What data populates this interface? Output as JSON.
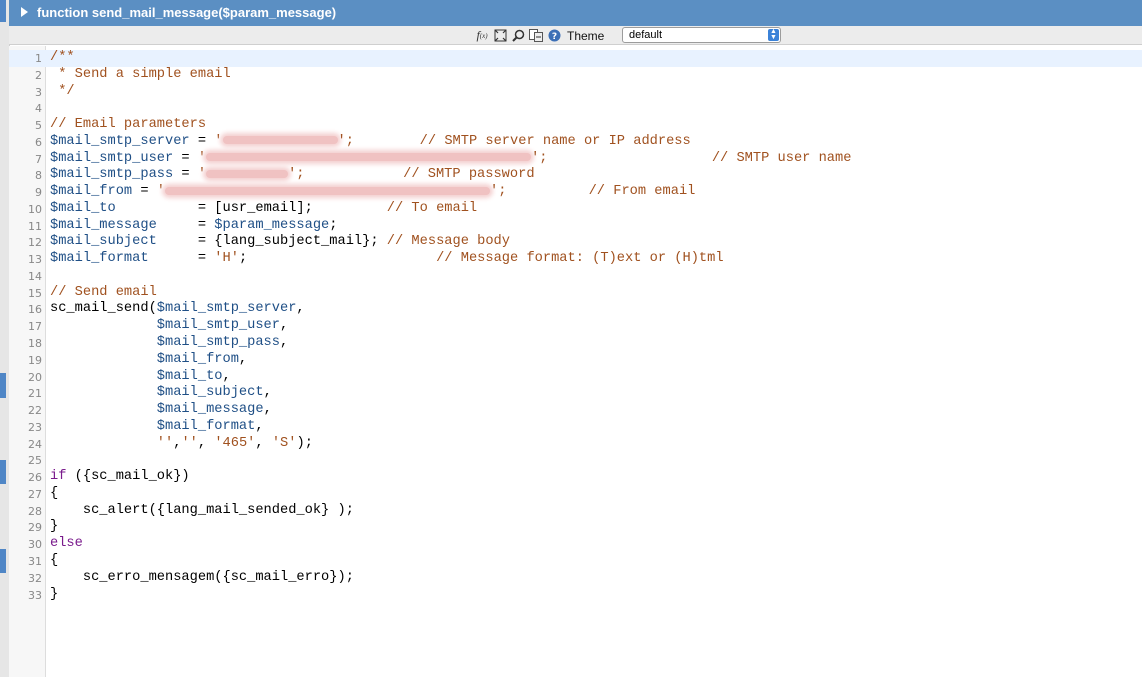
{
  "window": {
    "function_title": "function send_mail_message($param_message)"
  },
  "toolbar": {
    "icons": [
      "function-icon",
      "fullscreen-icon",
      "search-icon",
      "replace-icon",
      "help-icon"
    ],
    "theme_label": "Theme",
    "theme_value": "default"
  },
  "editor": {
    "active_line": 1,
    "lines": [
      {
        "n": "1",
        "t": [
          {
            "s": "/**",
            "c": "com"
          }
        ]
      },
      {
        "n": "2",
        "t": [
          {
            "s": " * Send a simple email",
            "c": "com"
          }
        ]
      },
      {
        "n": "3",
        "t": [
          {
            "s": " */",
            "c": "com"
          }
        ]
      },
      {
        "n": "4",
        "t": []
      },
      {
        "n": "5",
        "t": [
          {
            "s": "// Email parameters",
            "c": "com"
          }
        ]
      },
      {
        "n": "6",
        "t": [
          {
            "s": "$mail_smtp_server",
            "c": "var"
          },
          {
            "s": " = "
          },
          {
            "s": "'",
            "c": "str"
          },
          {
            "blur": 115
          },
          {
            "s": "';",
            "c": "str"
          },
          {
            "s": "        "
          },
          {
            "s": "// SMTP server name or IP address",
            "c": "com"
          }
        ]
      },
      {
        "n": "7",
        "t": [
          {
            "s": "$mail_smtp_user",
            "c": "var"
          },
          {
            "s": " = "
          },
          {
            "s": "'",
            "c": "str"
          },
          {
            "blur": 325
          },
          {
            "s": "';",
            "c": "str"
          },
          {
            "s": "                    "
          },
          {
            "s": "// SMTP user name",
            "c": "com"
          }
        ]
      },
      {
        "n": "8",
        "t": [
          {
            "s": "$mail_smtp_pass",
            "c": "var"
          },
          {
            "s": " = "
          },
          {
            "s": "'",
            "c": "str"
          },
          {
            "blur": 82
          },
          {
            "s": "';",
            "c": "str"
          },
          {
            "s": "            "
          },
          {
            "s": "// SMTP password",
            "c": "com"
          }
        ]
      },
      {
        "n": "9",
        "t": [
          {
            "s": "$mail_from",
            "c": "var"
          },
          {
            "s": " = "
          },
          {
            "s": "'",
            "c": "str"
          },
          {
            "blur": 325
          },
          {
            "s": "';",
            "c": "str"
          },
          {
            "s": "          "
          },
          {
            "s": "// From email",
            "c": "com"
          }
        ]
      },
      {
        "n": "10",
        "t": [
          {
            "s": "$mail_to",
            "c": "var"
          },
          {
            "s": "          = [usr_email];         "
          },
          {
            "s": "// To email",
            "c": "com"
          }
        ]
      },
      {
        "n": "11",
        "t": [
          {
            "s": "$mail_message",
            "c": "var"
          },
          {
            "s": "     = "
          },
          {
            "s": "$param_message",
            "c": "var"
          },
          {
            "s": ";"
          }
        ]
      },
      {
        "n": "12",
        "t": [
          {
            "s": "$mail_subject",
            "c": "var"
          },
          {
            "s": "     = {lang_subject_mail}; "
          },
          {
            "s": "// Message body",
            "c": "com"
          }
        ]
      },
      {
        "n": "13",
        "t": [
          {
            "s": "$mail_format",
            "c": "var"
          },
          {
            "s": "      = "
          },
          {
            "s": "'H'",
            "c": "str"
          },
          {
            "s": ";                       "
          },
          {
            "s": "// Message format: (T)ext or (H)tml",
            "c": "com"
          }
        ]
      },
      {
        "n": "14",
        "t": []
      },
      {
        "n": "15",
        "t": [
          {
            "s": "// Send email",
            "c": "com"
          }
        ]
      },
      {
        "n": "16",
        "t": [
          {
            "s": "sc_mail_send("
          },
          {
            "s": "$mail_smtp_server",
            "c": "var"
          },
          {
            "s": ","
          }
        ]
      },
      {
        "n": "17",
        "t": [
          {
            "s": "             "
          },
          {
            "s": "$mail_smtp_user",
            "c": "var"
          },
          {
            "s": ","
          }
        ]
      },
      {
        "n": "18",
        "t": [
          {
            "s": "             "
          },
          {
            "s": "$mail_smtp_pass",
            "c": "var"
          },
          {
            "s": ","
          }
        ]
      },
      {
        "n": "19",
        "t": [
          {
            "s": "             "
          },
          {
            "s": "$mail_from",
            "c": "var"
          },
          {
            "s": ","
          }
        ]
      },
      {
        "n": "20",
        "t": [
          {
            "s": "             "
          },
          {
            "s": "$mail_to",
            "c": "var"
          },
          {
            "s": ","
          }
        ]
      },
      {
        "n": "21",
        "t": [
          {
            "s": "             "
          },
          {
            "s": "$mail_subject",
            "c": "var"
          },
          {
            "s": ","
          }
        ]
      },
      {
        "n": "22",
        "t": [
          {
            "s": "             "
          },
          {
            "s": "$mail_message",
            "c": "var"
          },
          {
            "s": ","
          }
        ]
      },
      {
        "n": "23",
        "t": [
          {
            "s": "             "
          },
          {
            "s": "$mail_format",
            "c": "var"
          },
          {
            "s": ","
          }
        ]
      },
      {
        "n": "24",
        "t": [
          {
            "s": "             "
          },
          {
            "s": "''",
            "c": "str"
          },
          {
            "s": ","
          },
          {
            "s": "''",
            "c": "str"
          },
          {
            "s": ", "
          },
          {
            "s": "'465'",
            "c": "str"
          },
          {
            "s": ", "
          },
          {
            "s": "'S'",
            "c": "str"
          },
          {
            "s": ");"
          }
        ]
      },
      {
        "n": "25",
        "t": []
      },
      {
        "n": "26",
        "t": [
          {
            "s": "if",
            "c": "kw"
          },
          {
            "s": " ({sc_mail_ok})"
          }
        ]
      },
      {
        "n": "27",
        "t": [
          {
            "s": "{"
          }
        ]
      },
      {
        "n": "28",
        "t": [
          {
            "s": "    sc_alert({lang_mail_sended_ok} );"
          }
        ]
      },
      {
        "n": "29",
        "t": [
          {
            "s": "}"
          }
        ]
      },
      {
        "n": "30",
        "t": [
          {
            "s": "else",
            "c": "kw"
          }
        ]
      },
      {
        "n": "31",
        "t": [
          {
            "s": "{"
          }
        ]
      },
      {
        "n": "32",
        "t": [
          {
            "s": "    sc_erro_mensagem({sc_mail_erro});"
          }
        ]
      },
      {
        "n": "33",
        "t": [
          {
            "s": "}"
          }
        ]
      }
    ]
  }
}
